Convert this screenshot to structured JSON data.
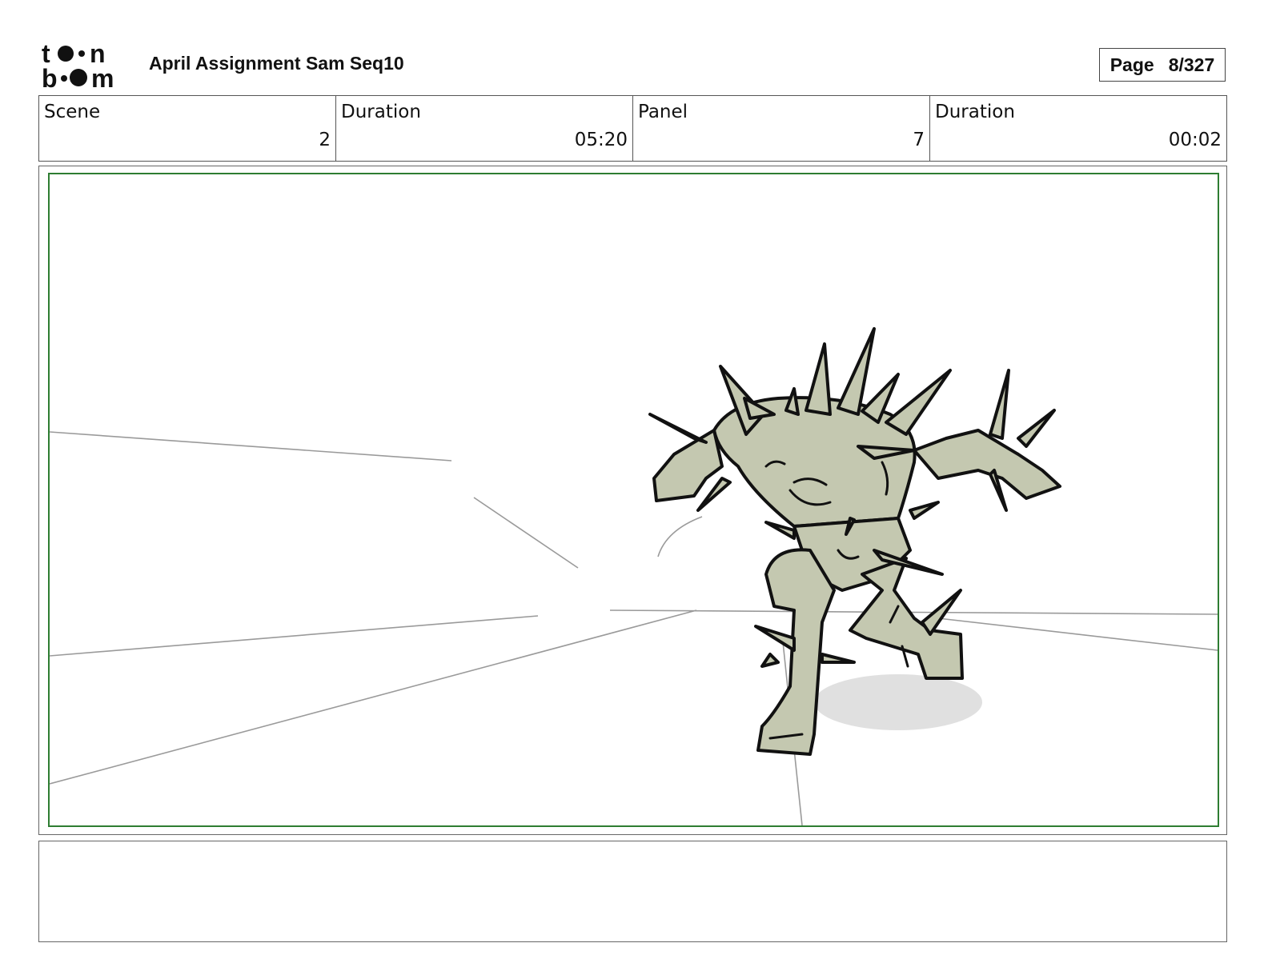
{
  "header": {
    "logo": {
      "line1": "toon",
      "line2": "boom",
      "icon": "toon-boom-logo"
    },
    "title": "April Assignment Sam Seq10",
    "page": {
      "label": "Page",
      "value": "8/327"
    }
  },
  "info": [
    {
      "label": "Scene",
      "value": "2"
    },
    {
      "label": "Duration",
      "value": "05:20"
    },
    {
      "label": "Panel",
      "value": "7"
    },
    {
      "label": "Duration",
      "value": "00:02"
    }
  ],
  "panel": {
    "safe_area_color": "#2e7d32",
    "character_fill": "#c4c8b0",
    "line_color": "#111111"
  },
  "notes": {
    "text": ""
  }
}
